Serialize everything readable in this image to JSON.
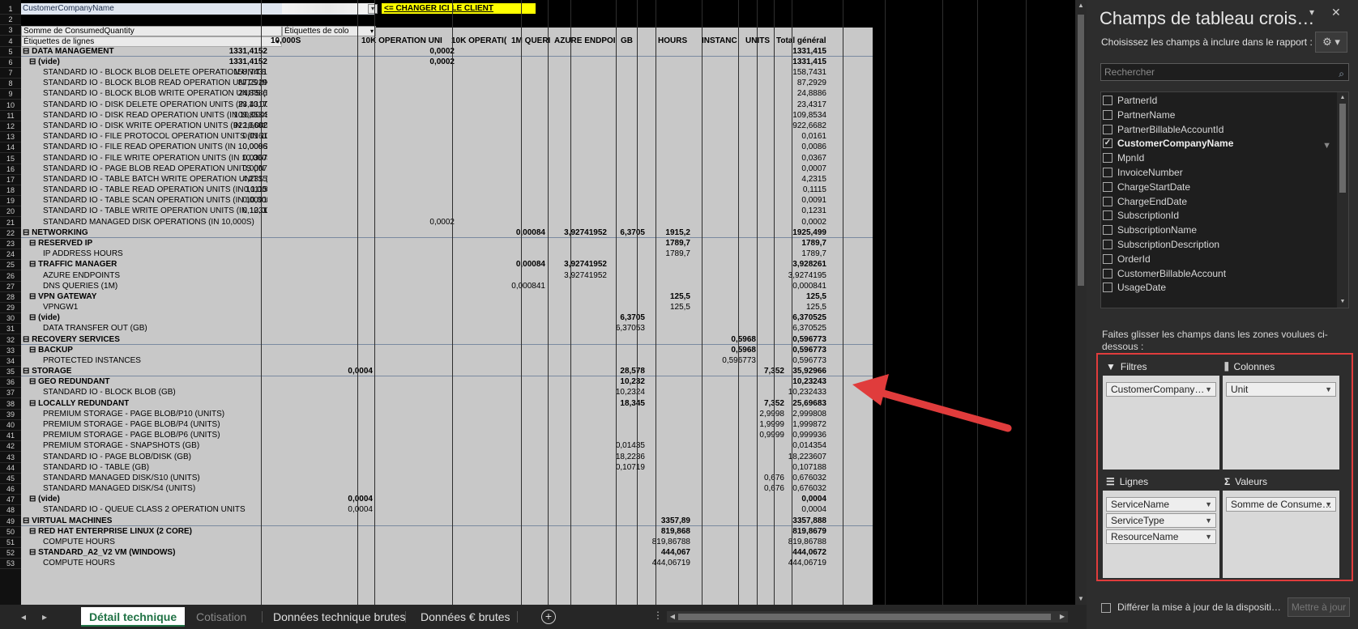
{
  "sheet": {
    "filter_label": "CustomerCompanyName",
    "change_client_note": "<= CHANGER ICI LE CLIENT",
    "values_header": "Somme de ConsumedQuantity",
    "column_labels_header": "Étiquettes de colo",
    "row_labels_header": "Étiquettes de lignes",
    "column_headers": [
      "10,000S",
      "10K OPERATION UNI",
      "10K OPERATI(",
      "1M QUERI",
      "AZURE ENDPOI",
      "GB",
      "HOURS",
      "INSTANC",
      "UNITS",
      "Total général"
    ],
    "rows": [
      {
        "l": "DATA MANAGEMENT",
        "lv": 0,
        "b": true,
        "v": [
          "1331,4152",
          "",
          "0,0002",
          "",
          "",
          "",
          "",
          "",
          "",
          "1331,415"
        ]
      },
      {
        "l": "(vide)",
        "lv": 1,
        "b": true,
        "v": [
          "1331,4152",
          "",
          "0,0002",
          "",
          "",
          "",
          "",
          "",
          "",
          "1331,415"
        ]
      },
      {
        "l": "STANDARD IO - BLOCK BLOB DELETE OPERATION UNITS (IN 10",
        "lv": 2,
        "v": [
          "158,7431",
          "",
          "",
          "",
          "",
          "",
          "",
          "",
          "",
          "158,7431"
        ]
      },
      {
        "l": "STANDARD IO - BLOCK BLOB READ OPERATION UNITS (IN 10,0",
        "lv": 2,
        "v": [
          "87,2929",
          "",
          "",
          "",
          "",
          "",
          "",
          "",
          "",
          "87,2929"
        ]
      },
      {
        "l": "STANDARD IO - BLOCK BLOB WRITE OPERATION UNITS (IN 10,(",
        "lv": 2,
        "v": [
          "24,8886",
          "",
          "",
          "",
          "",
          "",
          "",
          "",
          "",
          "24,8886"
        ]
      },
      {
        "l": "STANDARD IO - DISK DELETE OPERATION UNITS (IN 10,000S)",
        "lv": 2,
        "v": [
          "23,4317",
          "",
          "",
          "",
          "",
          "",
          "",
          "",
          "",
          "23,4317"
        ]
      },
      {
        "l": "STANDARD IO - DISK READ OPERATION UNITS (IN 10,000S)",
        "lv": 2,
        "v": [
          "109,8534",
          "",
          "",
          "",
          "",
          "",
          "",
          "",
          "",
          "109,8534"
        ]
      },
      {
        "l": "STANDARD IO - DISK WRITE OPERATION UNITS (IN 10,000S)",
        "lv": 2,
        "v": [
          "922,6682",
          "",
          "",
          "",
          "",
          "",
          "",
          "",
          "",
          "922,6682"
        ]
      },
      {
        "l": "STANDARD IO - FILE PROTOCOL OPERATION UNITS (IN 10,000S",
        "lv": 2,
        "v": [
          "0,0161",
          "",
          "",
          "",
          "",
          "",
          "",
          "",
          "",
          "0,0161"
        ]
      },
      {
        "l": "STANDARD IO - FILE READ OPERATION UNITS (IN 10,000S)",
        "lv": 2,
        "v": [
          "0,0086",
          "",
          "",
          "",
          "",
          "",
          "",
          "",
          "",
          "0,0086"
        ]
      },
      {
        "l": "STANDARD IO - FILE WRITE OPERATION UNITS (IN 10,000S)",
        "lv": 2,
        "v": [
          "0,0367",
          "",
          "",
          "",
          "",
          "",
          "",
          "",
          "",
          "0,0367"
        ]
      },
      {
        "l": "STANDARD IO - PAGE BLOB READ OPERATION UNITS (IN 10,00",
        "lv": 2,
        "v": [
          "0,0007",
          "",
          "",
          "",
          "",
          "",
          "",
          "",
          "",
          "0,0007"
        ]
      },
      {
        "l": "STANDARD IO - TABLE BATCH WRITE OPERATION UNITS (IN 10,",
        "lv": 2,
        "v": [
          "4,2315",
          "",
          "",
          "",
          "",
          "",
          "",
          "",
          "",
          "4,2315"
        ]
      },
      {
        "l": "STANDARD IO - TABLE READ OPERATION UNITS (IN 10,000S)",
        "lv": 2,
        "v": [
          "0,1115",
          "",
          "",
          "",
          "",
          "",
          "",
          "",
          "",
          "0,1115"
        ]
      },
      {
        "l": "STANDARD IO - TABLE SCAN OPERATION UNITS (IN 10,000S)",
        "lv": 2,
        "v": [
          "0,0091",
          "",
          "",
          "",
          "",
          "",
          "",
          "",
          "",
          "0,0091"
        ]
      },
      {
        "l": "STANDARD IO - TABLE WRITE OPERATION UNITS (IN 10,000S)",
        "lv": 2,
        "v": [
          "0,1231",
          "",
          "",
          "",
          "",
          "",
          "",
          "",
          "",
          "0,1231"
        ]
      },
      {
        "l": "STANDARD MANAGED DISK OPERATIONS (IN 10,000S)",
        "lv": 2,
        "v": [
          "",
          "",
          "0,0002",
          "",
          "",
          "",
          "",
          "",
          "",
          "0,0002"
        ]
      },
      {
        "l": "NETWORKING",
        "lv": 0,
        "b": true,
        "v": [
          "",
          "",
          "",
          "0,00084",
          "3,92741952",
          "6,3705",
          "1915,2",
          "",
          "",
          "1925,499"
        ]
      },
      {
        "l": "RESERVED IP",
        "lv": 1,
        "b": true,
        "v": [
          "",
          "",
          "",
          "",
          "",
          "",
          "1789,7",
          "",
          "",
          "1789,7"
        ]
      },
      {
        "l": "IP ADDRESS HOURS",
        "lv": 2,
        "v": [
          "",
          "",
          "",
          "",
          "",
          "",
          "1789,7",
          "",
          "",
          "1789,7"
        ]
      },
      {
        "l": "TRAFFIC MANAGER",
        "lv": 1,
        "b": true,
        "v": [
          "",
          "",
          "",
          "0,00084",
          "3,92741952",
          "",
          "",
          "",
          "",
          "3,928261"
        ]
      },
      {
        "l": "AZURE ENDPOINTS",
        "lv": 2,
        "v": [
          "",
          "",
          "",
          "",
          "3,92741952",
          "",
          "",
          "",
          "",
          "3,9274195"
        ]
      },
      {
        "l": "DNS QUERIES (1M)",
        "lv": 2,
        "v": [
          "",
          "",
          "",
          "0,000841",
          "",
          "",
          "",
          "",
          "",
          "0,000841"
        ]
      },
      {
        "l": "VPN GATEWAY",
        "lv": 1,
        "b": true,
        "v": [
          "",
          "",
          "",
          "",
          "",
          "",
          "125,5",
          "",
          "",
          "125,5"
        ]
      },
      {
        "l": "VPNGW1",
        "lv": 2,
        "v": [
          "",
          "",
          "",
          "",
          "",
          "",
          "125,5",
          "",
          "",
          "125,5"
        ]
      },
      {
        "l": "(vide)",
        "lv": 1,
        "b": true,
        "v": [
          "",
          "",
          "",
          "",
          "",
          "6,3705",
          "",
          "",
          "",
          "6,370525"
        ]
      },
      {
        "l": "DATA TRANSFER OUT (GB)",
        "lv": 2,
        "v": [
          "",
          "",
          "",
          "",
          "",
          "6,37053",
          "",
          "",
          "",
          "6,370525"
        ]
      },
      {
        "l": "RECOVERY SERVICES",
        "lv": 0,
        "b": true,
        "v": [
          "",
          "",
          "",
          "",
          "",
          "",
          "",
          "0,5968",
          "",
          "0,596773"
        ]
      },
      {
        "l": "BACKUP",
        "lv": 1,
        "b": true,
        "v": [
          "",
          "",
          "",
          "",
          "",
          "",
          "",
          "0,5968",
          "",
          "0,596773"
        ]
      },
      {
        "l": "PROTECTED INSTANCES",
        "lv": 2,
        "v": [
          "",
          "",
          "",
          "",
          "",
          "",
          "",
          "0,596773",
          "",
          "0,596773"
        ]
      },
      {
        "l": "STORAGE",
        "lv": 0,
        "b": true,
        "v": [
          "",
          "0,0004",
          "",
          "",
          "",
          "28,578",
          "",
          "",
          "7,352",
          "35,92966"
        ]
      },
      {
        "l": "GEO REDUNDANT",
        "lv": 1,
        "b": true,
        "v": [
          "",
          "",
          "",
          "",
          "",
          "10,232",
          "",
          "",
          "",
          "10,23243"
        ]
      },
      {
        "l": "STANDARD IO - BLOCK BLOB (GB)",
        "lv": 2,
        "v": [
          "",
          "",
          "",
          "",
          "",
          "10,2324",
          "",
          "",
          "",
          "10,232433"
        ]
      },
      {
        "l": "LOCALLY REDUNDANT",
        "lv": 1,
        "b": true,
        "v": [
          "",
          "",
          "",
          "",
          "",
          "18,345",
          "",
          "",
          "7,352",
          "25,69683"
        ]
      },
      {
        "l": "PREMIUM STORAGE - PAGE BLOB/P10 (UNITS)",
        "lv": 2,
        "v": [
          "",
          "",
          "",
          "",
          "",
          "",
          "",
          "",
          "2,9998",
          "2,999808"
        ]
      },
      {
        "l": "PREMIUM STORAGE - PAGE BLOB/P4 (UNITS)",
        "lv": 2,
        "v": [
          "",
          "",
          "",
          "",
          "",
          "",
          "",
          "",
          "1,9999",
          "1,999872"
        ]
      },
      {
        "l": "PREMIUM STORAGE - PAGE BLOB/P6 (UNITS)",
        "lv": 2,
        "v": [
          "",
          "",
          "",
          "",
          "",
          "",
          "",
          "",
          "0,9999",
          "0,999936"
        ]
      },
      {
        "l": "PREMIUM STORAGE - SNAPSHOTS (GB)",
        "lv": 2,
        "v": [
          "",
          "",
          "",
          "",
          "",
          "0,01435",
          "",
          "",
          "",
          "0,014354"
        ]
      },
      {
        "l": "STANDARD IO - PAGE BLOB/DISK (GB)",
        "lv": 2,
        "v": [
          "",
          "",
          "",
          "",
          "",
          "18,2236",
          "",
          "",
          "",
          "18,223607"
        ]
      },
      {
        "l": "STANDARD IO - TABLE (GB)",
        "lv": 2,
        "v": [
          "",
          "",
          "",
          "",
          "",
          "0,10719",
          "",
          "",
          "",
          "0,107188"
        ]
      },
      {
        "l": "STANDARD MANAGED DISK/S10 (UNITS)",
        "lv": 2,
        "v": [
          "",
          "",
          "",
          "",
          "",
          "",
          "",
          "",
          "0,676",
          "0,676032"
        ]
      },
      {
        "l": "STANDARD MANAGED DISK/S4 (UNITS)",
        "lv": 2,
        "v": [
          "",
          "",
          "",
          "",
          "",
          "",
          "",
          "",
          "0,676",
          "0,676032"
        ]
      },
      {
        "l": "(vide)",
        "lv": 1,
        "b": true,
        "v": [
          "",
          "0,0004",
          "",
          "",
          "",
          "",
          "",
          "",
          "",
          "0,0004"
        ]
      },
      {
        "l": "STANDARD IO - QUEUE CLASS 2 OPERATION UNITS",
        "lv": 2,
        "v": [
          "",
          "0,0004",
          "",
          "",
          "",
          "",
          "",
          "",
          "",
          "0,0004"
        ]
      },
      {
        "l": "VIRTUAL MACHINES",
        "lv": 0,
        "b": true,
        "v": [
          "",
          "",
          "",
          "",
          "",
          "",
          "3357,89",
          "",
          "",
          "3357,888"
        ]
      },
      {
        "l": "RED HAT ENTERPRISE LINUX (2 CORE)",
        "lv": 1,
        "b": true,
        "v": [
          "",
          "",
          "",
          "",
          "",
          "",
          "819,868",
          "",
          "",
          "819,8679"
        ]
      },
      {
        "l": "COMPUTE HOURS",
        "lv": 2,
        "v": [
          "",
          "",
          "",
          "",
          "",
          "",
          "819,86788",
          "",
          "",
          "819,86788"
        ]
      },
      {
        "l": "STANDARD_A2_V2 VM (WINDOWS)",
        "lv": 1,
        "b": true,
        "v": [
          "",
          "",
          "",
          "",
          "",
          "",
          "444,067",
          "",
          "",
          "444,0672"
        ]
      },
      {
        "l": "COMPUTE HOURS",
        "lv": 2,
        "v": [
          "",
          "",
          "",
          "",
          "",
          "",
          "444,06719",
          "",
          "",
          "444,06719"
        ]
      }
    ]
  },
  "tabs": [
    "Détail technique",
    "Cotisation",
    "Données technique brutes",
    "Données € brutes"
  ],
  "panel": {
    "title": "Champs de tableau crois…",
    "subtitle": "Choisissez les champs à inclure dans le rapport :",
    "search_placeholder": "Rechercher",
    "fields": [
      {
        "name": "PartnerId",
        "checked": false
      },
      {
        "name": "PartnerName",
        "checked": false
      },
      {
        "name": "PartnerBillableAccountId",
        "checked": false
      },
      {
        "name": "CustomerCompanyName",
        "checked": true
      },
      {
        "name": "MpnId",
        "checked": false
      },
      {
        "name": "InvoiceNumber",
        "checked": false
      },
      {
        "name": "ChargeStartDate",
        "checked": false
      },
      {
        "name": "ChargeEndDate",
        "checked": false
      },
      {
        "name": "SubscriptionId",
        "checked": false
      },
      {
        "name": "SubscriptionName",
        "checked": false
      },
      {
        "name": "SubscriptionDescription",
        "checked": false
      },
      {
        "name": "OrderId",
        "checked": false
      },
      {
        "name": "CustomerBillableAccount",
        "checked": false
      },
      {
        "name": "UsageDate",
        "checked": false
      }
    ],
    "drag_text": "Faites glisser les champs dans les zones voulues ci-dessous :",
    "areas": {
      "filters": {
        "label": "Filtres",
        "chips": [
          "CustomerCompany…"
        ]
      },
      "columns": {
        "label": "Colonnes",
        "chips": [
          "Unit"
        ]
      },
      "rows": {
        "label": "Lignes",
        "chips": [
          "ServiceName",
          "ServiceType",
          "ResourceName"
        ]
      },
      "values": {
        "label": "Valeurs",
        "chips": [
          "Somme de Consume…"
        ]
      }
    },
    "defer_text": "Différer la mise à jour de la dispositi…",
    "update_button": "Mettre à jour"
  }
}
